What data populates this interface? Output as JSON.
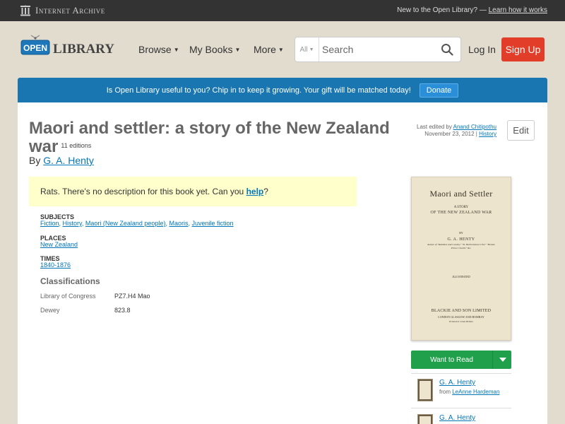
{
  "ia_bar": {
    "logo_text": "Internet Archive",
    "new_text": "New to the Open Library? —",
    "learn_link": "Learn how it works"
  },
  "header": {
    "logo_open": "OPEN",
    "logo_library": "LIBRARY",
    "nav": [
      "Browse",
      "My Books",
      "More"
    ],
    "search_scope": "All",
    "search_placeholder": "Search",
    "login": "Log In",
    "signup": "Sign Up"
  },
  "banner": {
    "text": "Is Open Library useful to you? Chip in to keep it growing. Your gift will be matched today!",
    "donate": "Donate"
  },
  "book": {
    "title": "Maori and settler: a story of the New Zealand war",
    "editions": "11 editions",
    "by": "By",
    "author": "G. A. Henty",
    "last_edited_label": "Last edited by",
    "last_edited_user": "Anand Chitipothu",
    "last_edited_date": "November 23, 2012",
    "separator": "|",
    "history": "History",
    "edit": "Edit",
    "no_desc_text": "Rats. There's no description for this book yet. Can you",
    "no_desc_link": "help",
    "no_desc_end": "?"
  },
  "subjects": {
    "head": "SUBJECTS",
    "items": [
      "Fiction",
      "History",
      "Maori (New Zealand people)",
      "Maoris",
      "Juvenile fiction"
    ]
  },
  "places": {
    "head": "PLACES",
    "items": [
      "New Zealand"
    ]
  },
  "times": {
    "head": "TIMES",
    "items": [
      "1840-1876"
    ]
  },
  "classifications": {
    "head": "Classifications",
    "rows": [
      {
        "key": "Library of Congress",
        "value": "PZ7.H4 Mao"
      },
      {
        "key": "Dewey",
        "value": "823.8"
      }
    ]
  },
  "cover": {
    "title": "Maori and Settler",
    "sub1": "A STORY",
    "sub2": "OF THE NEW ZEALAND WAR",
    "by": "BY",
    "author": "G. A. HENTY",
    "author_desc": "Author of \"Redskins and Cowboy\" \"St. Bartholomew's Eve\" \"Bonnie Prince Charlie\" &c.",
    "illustrated": "ILLUSTRATED",
    "publisher": "BLACKIE AND SON LIMITED",
    "cities": "LONDON GLASGOW AND BOMBAY",
    "printed": "Printed in Great Britain"
  },
  "actions": {
    "want_to_read": "Want to Read"
  },
  "lists": [
    {
      "name": "G. A. Henty",
      "from_label": "from",
      "from_user": "LeAnne Hardeman"
    },
    {
      "name": "G. A. Henty",
      "from_label": "",
      "from_user": ""
    }
  ],
  "colors": {
    "ia_bar": "#333333",
    "banner": "#1976b0",
    "signup": "#e23d28",
    "want_to_read": "#21a04b",
    "link": "#0376b8"
  }
}
